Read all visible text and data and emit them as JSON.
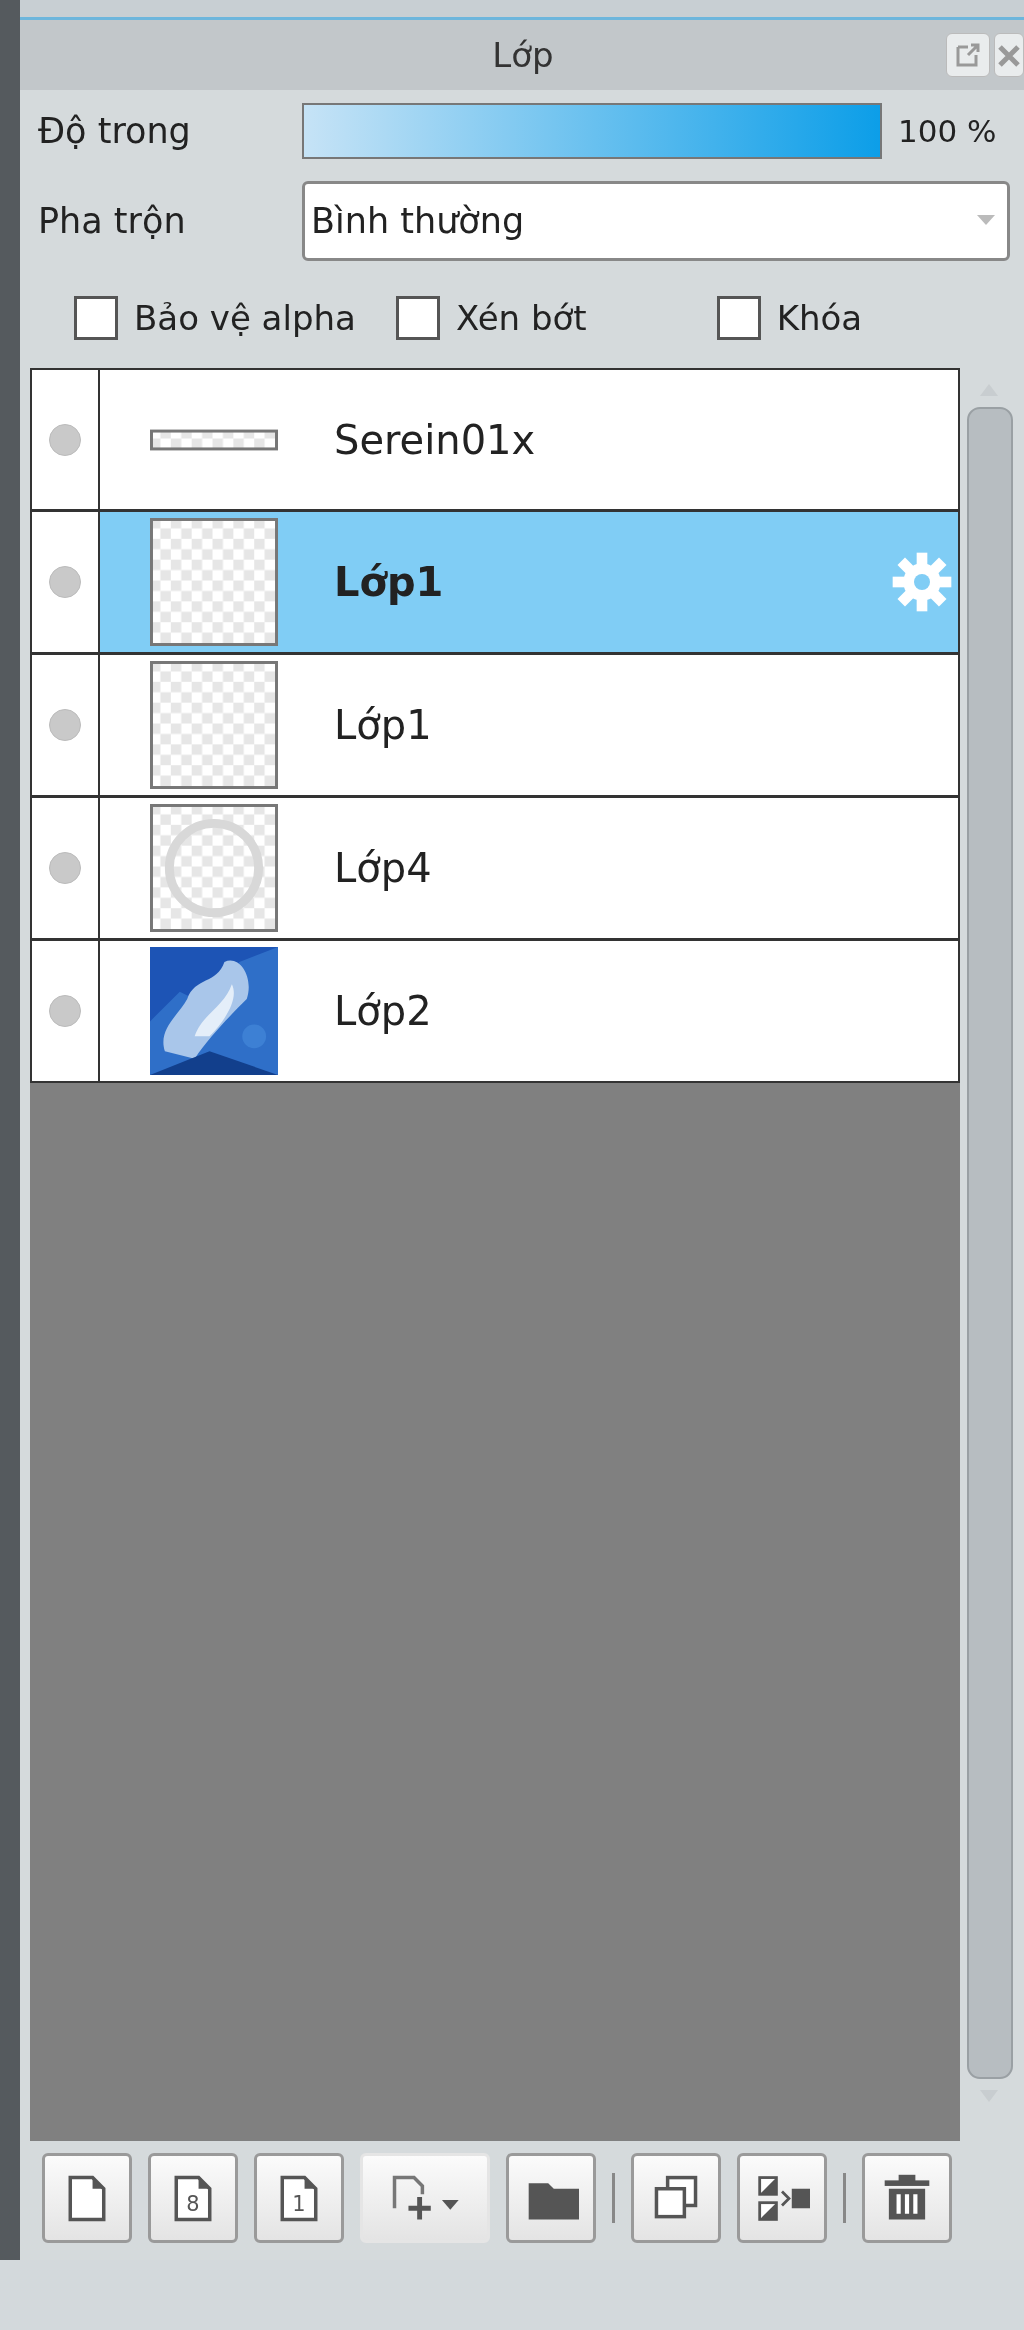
{
  "panel": {
    "title": "Lớp"
  },
  "opacity": {
    "label": "Độ trong",
    "level": 1.0,
    "reading": "100 %"
  },
  "blend": {
    "label": "Pha trộn",
    "value": "Bình thường"
  },
  "options": [
    {
      "label": "Bảo vệ alpha",
      "checked": false
    },
    {
      "label": "Xén bớt",
      "checked": false
    },
    {
      "label": "Khóa",
      "checked": false
    }
  ],
  "layers": [
    {
      "name": "Serein01x",
      "thumbnail": {
        "kind": "strip"
      },
      "selected": false
    },
    {
      "name": "Lớp1",
      "thumbnail": {
        "kind": "transparent"
      },
      "selected": true
    },
    {
      "name": "Lớp1",
      "thumbnail": {
        "kind": "transparent"
      },
      "selected": false
    },
    {
      "name": "Lớp4",
      "thumbnail": {
        "kind": "circle"
      },
      "selected": false
    },
    {
      "name": "Lớp2",
      "selected": false
    }
  ],
  "toolbar": [
    {
      "kind": "new"
    },
    {
      "kind": "new-number",
      "badge": "8"
    },
    {
      "kind": "new-number",
      "badge": "1"
    },
    {
      "kind": "add-menu"
    },
    {
      "kind": "folder"
    },
    {
      "kind": "separator"
    },
    {
      "kind": "duplicate"
    },
    {
      "kind": "merge"
    },
    {
      "kind": "separator"
    },
    {
      "kind": "delete"
    }
  ]
}
